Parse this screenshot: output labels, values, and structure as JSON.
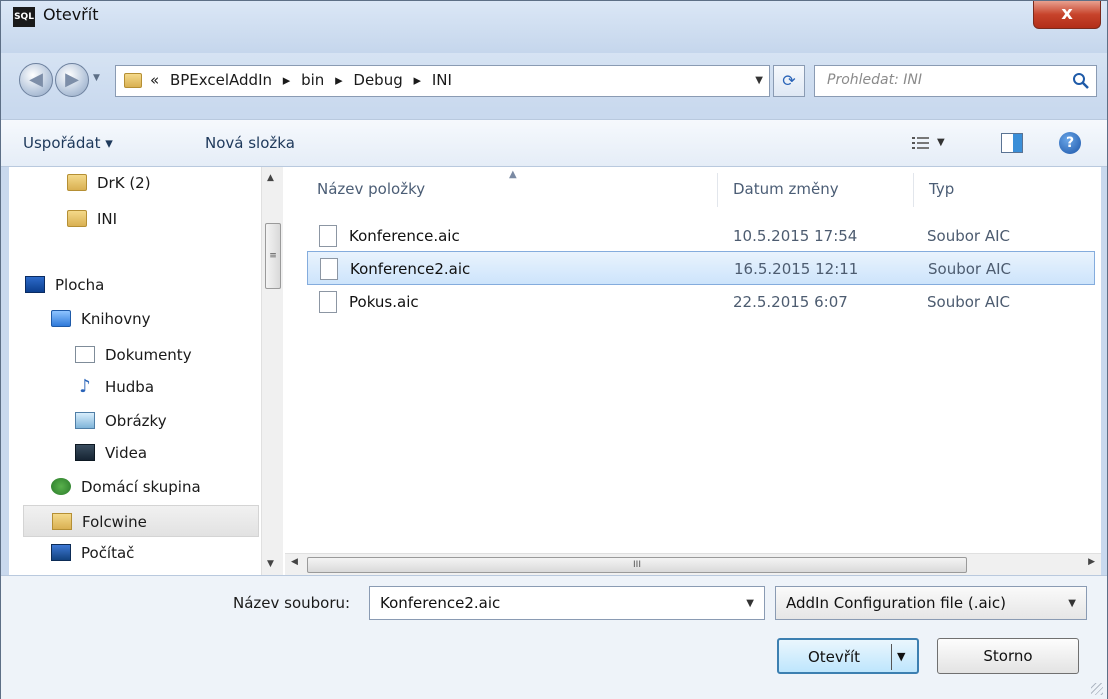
{
  "window": {
    "title": "Otevřít",
    "app_icon_text": "SQL",
    "close_label": "x"
  },
  "navigation": {
    "back_icon": "arrow-left-icon",
    "forward_icon": "arrow-right-icon",
    "breadcrumb_prefix": "«",
    "breadcrumbs": [
      "BPExcelAddIn",
      "bin",
      "Debug",
      "INI"
    ],
    "breadcrumb_separator": "▸",
    "refresh_icon": "refresh-icon",
    "search_placeholder": "Prohledat: INI"
  },
  "toolbar": {
    "organize_label": "Uspořádat ▾",
    "new_folder_label": "Nová složka"
  },
  "nav_tree": {
    "items": [
      {
        "label": "DrK (2)",
        "icon": "folder-icon"
      },
      {
        "label": "INI",
        "icon": "folder-icon"
      },
      {
        "label": "Plocha",
        "icon": "desktop-icon"
      },
      {
        "label": "Knihovny",
        "icon": "library-icon"
      },
      {
        "label": "Dokumenty",
        "icon": "documents-icon"
      },
      {
        "label": "Hudba",
        "icon": "music-icon"
      },
      {
        "label": "Obrázky",
        "icon": "pictures-icon"
      },
      {
        "label": "Videa",
        "icon": "video-icon"
      },
      {
        "label": "Domácí skupina",
        "icon": "homegroup-icon"
      },
      {
        "label": "Folcwine",
        "icon": "user-folder-icon",
        "selected": true
      },
      {
        "label": "Počítač",
        "icon": "computer-icon"
      }
    ]
  },
  "file_list": {
    "columns": [
      "Název položky",
      "Datum změny",
      "Typ"
    ],
    "rows": [
      {
        "name": "Konference.aic",
        "date": "10.5.2015 17:54",
        "type": "Soubor AIC",
        "selected": false
      },
      {
        "name": "Konference2.aic",
        "date": "16.5.2015 12:11",
        "type": "Soubor AIC",
        "selected": true
      },
      {
        "name": "Pokus.aic",
        "date": "22.5.2015 6:07",
        "type": "Soubor AIC",
        "selected": false
      }
    ]
  },
  "footer": {
    "filename_label": "Název souboru:",
    "filename_value": "Konference2.aic",
    "filetype_value": "AddIn Configuration file (.aic)",
    "open_label": "Otevřít",
    "cancel_label": "Storno"
  },
  "colors": {
    "accent": "#3c7fb1",
    "selection": "#cde4fb",
    "window_frame": "#c9d9ee"
  }
}
